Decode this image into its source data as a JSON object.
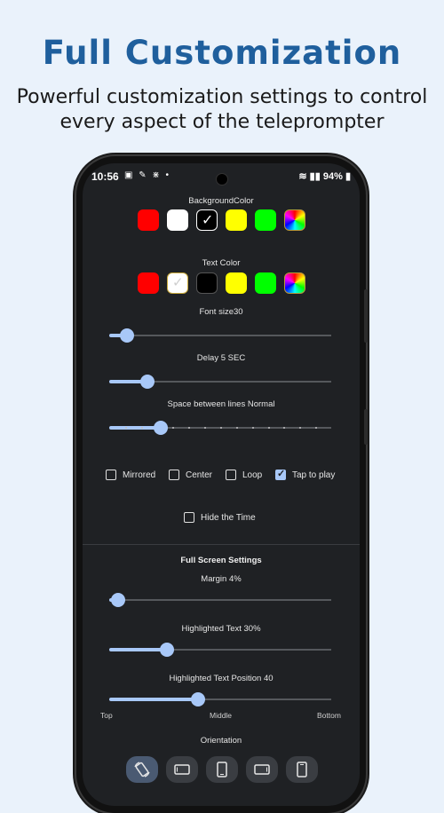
{
  "headline": "Full Customization",
  "subline": "Powerful customization settings to control every aspect of the teleprompter",
  "status_bar": {
    "time": "10:56",
    "battery": "94%"
  },
  "background_color": {
    "label": "BackgroundColor",
    "swatches": [
      "#ff0000",
      "#ffffff",
      "#000000",
      "#ffff00",
      "#00ff00",
      "color-wheel"
    ],
    "selected_index": 2
  },
  "text_color": {
    "label": "Text Color",
    "swatches": [
      "#ff0000",
      "#ffffff",
      "#000000",
      "#ffff00",
      "#00ff00",
      "color-wheel"
    ],
    "selected_index": 1
  },
  "font_size": {
    "label": "Font size30",
    "level": 0.08
  },
  "delay": {
    "label": "Delay  5 SEC",
    "level": 0.17
  },
  "line_spacing": {
    "label": "Space between lines  Normal",
    "level": 0.23
  },
  "options": [
    {
      "label": "Mirrored",
      "checked": false
    },
    {
      "label": "Center",
      "checked": false
    },
    {
      "label": "Loop",
      "checked": false
    },
    {
      "label": "Tap to play",
      "checked": true
    }
  ],
  "hide_time": {
    "label": "Hide the Time",
    "checked": false
  },
  "full_screen": {
    "title": "Full Screen Settings",
    "margin": {
      "label": "Margin 4%",
      "level": 0.04
    },
    "highlighted_text": {
      "label": "Highlighted Text 30%",
      "level": 0.26
    },
    "highlighted_position": {
      "label": "Highlighted Text Position 40",
      "level": 0.4
    },
    "position_labels": {
      "top": "Top",
      "middle": "Middle",
      "bottom": "Bottom"
    },
    "orientation_label": "Orientation",
    "orientations": [
      "auto-rotate-icon",
      "landscape-icon",
      "portrait-icon",
      "reverse-landscape-icon",
      "reverse-portrait-icon"
    ]
  },
  "colors": {
    "accent": "#a8c8f8",
    "screen_bg": "#1f2124",
    "headline": "#1f5f9d"
  }
}
